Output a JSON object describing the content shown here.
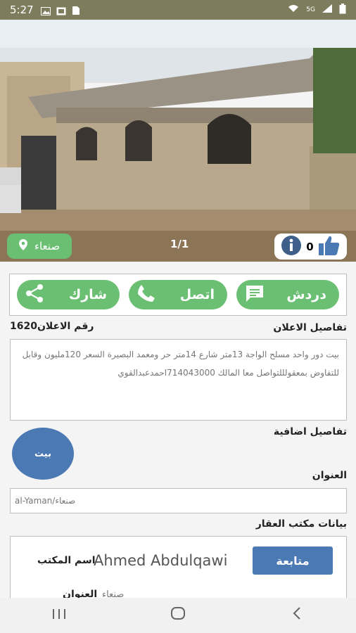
{
  "status_bar": {
    "time": "5:27",
    "network": "5G"
  },
  "photo": {
    "location": "صنعاء",
    "counter": "1/1",
    "likes": "0"
  },
  "actions": {
    "share": "شارك",
    "call": "اتصل",
    "chat": "دردش"
  },
  "ad": {
    "number_label": "رقم الاعلان1620",
    "details_title": "تفاصيل الاعلان",
    "description": "بيت دور واحد مسلح الواجة 13متر شارع 14متر حر ومعمد البصيرة السعر 120مليون وقابل للتفاوض بمعقولللتواصل معا المالك 714043000احمدعبدالقوي"
  },
  "extra": {
    "title": "تفاصيل اضافية",
    "type": "بيت"
  },
  "address": {
    "title": "العنوان",
    "value": "al-Yaman/صنعاء"
  },
  "office": {
    "section_title": "بيانات مكتب العقار",
    "follow": "متابعة",
    "name": "Ahmed Abdulqawi",
    "name_label": "اسم المكتب",
    "address_label": "العنوان",
    "address_value": "صنعاء"
  },
  "colors": {
    "accent_green": "#6bbf73",
    "accent_blue": "#4a79b4",
    "status_bar": "#7d7d5e"
  }
}
